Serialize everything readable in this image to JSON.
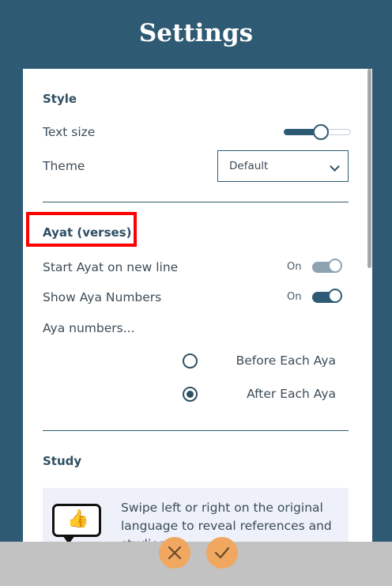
{
  "header": {
    "title": "Settings"
  },
  "style_section": {
    "title": "Style",
    "text_size_label": "Text size",
    "text_size_level": 0.55,
    "theme_label": "Theme",
    "theme_value": "Default"
  },
  "ayat_section": {
    "title": "Ayat (verses)",
    "start_new_line": {
      "label": "Start Ayat on new line",
      "state": "On",
      "enabled": true
    },
    "show_numbers": {
      "label": "Show Aya Numbers",
      "state": "On",
      "enabled": true
    },
    "numbers_position_label": "Aya numbers...",
    "options": [
      {
        "label": "Before Each Aya",
        "selected": false
      },
      {
        "label": "After Each Aya",
        "selected": true
      }
    ]
  },
  "study_section": {
    "title": "Study",
    "tip_text": "Swipe left or right on the original language to reveal references and studies."
  },
  "footer": {
    "cancel_icon": "close-icon",
    "confirm_icon": "check-icon"
  },
  "colors": {
    "primary": "#2f5a73",
    "accent": "#f0a860",
    "highlight": "#ff0000"
  }
}
